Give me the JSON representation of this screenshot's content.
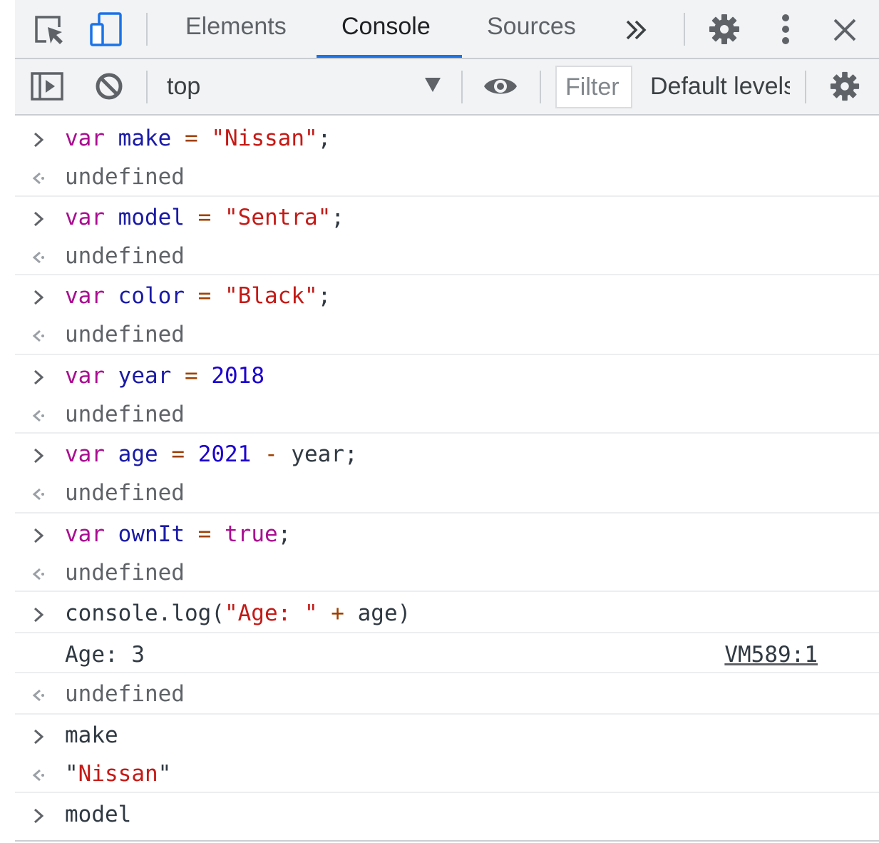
{
  "tabbar": {
    "tabs": [
      {
        "label": "Elements",
        "active": false
      },
      {
        "label": "Console",
        "active": true
      },
      {
        "label": "Sources",
        "active": false
      }
    ],
    "more_tabs_glyph": "»",
    "icons": [
      "inspect-element-icon",
      "device-toolbar-icon",
      "more-tabs-icon",
      "settings-gear-icon",
      "kebab-menu-icon",
      "close-icon"
    ]
  },
  "toolbar": {
    "context": "top",
    "filter_placeholder": "Filter",
    "filter_value": "",
    "levels": "Default levels",
    "icons": [
      "sidebar-toggle-icon",
      "clear-console-icon",
      "context-dropdown-icon",
      "live-expression-eye-icon",
      "console-settings-gear-icon"
    ]
  },
  "colors": {
    "accent": "#1a73e8",
    "keyword": "#aa0d91",
    "variable": "#1a1aa6",
    "string": "#c41a16",
    "number": "#1c00cf",
    "operator": "#a04000",
    "text": "#303942"
  },
  "console": {
    "entries": [
      {
        "kind": "input",
        "tokens": [
          [
            "kw",
            "var"
          ],
          [
            "pl",
            " "
          ],
          [
            "vd",
            "make"
          ],
          [
            "pl",
            " "
          ],
          [
            "op",
            "="
          ],
          [
            "pl",
            " "
          ],
          [
            "st",
            "\"Nissan\""
          ],
          [
            "pl",
            ";"
          ]
        ]
      },
      {
        "kind": "result",
        "tokens": [
          [
            "res",
            "undefined"
          ]
        ]
      },
      {
        "kind": "input",
        "tokens": [
          [
            "kw",
            "var"
          ],
          [
            "pl",
            " "
          ],
          [
            "vd",
            "model"
          ],
          [
            "pl",
            " "
          ],
          [
            "op",
            "="
          ],
          [
            "pl",
            " "
          ],
          [
            "st",
            "\"Sentra\""
          ],
          [
            "pl",
            ";"
          ]
        ]
      },
      {
        "kind": "result",
        "tokens": [
          [
            "res",
            "undefined"
          ]
        ]
      },
      {
        "kind": "input",
        "tokens": [
          [
            "kw",
            "var"
          ],
          [
            "pl",
            " "
          ],
          [
            "vd",
            "color"
          ],
          [
            "pl",
            " "
          ],
          [
            "op",
            "="
          ],
          [
            "pl",
            " "
          ],
          [
            "st",
            "\"Black\""
          ],
          [
            "pl",
            ";"
          ]
        ]
      },
      {
        "kind": "result",
        "tokens": [
          [
            "res",
            "undefined"
          ]
        ]
      },
      {
        "kind": "input",
        "tokens": [
          [
            "kw",
            "var"
          ],
          [
            "pl",
            " "
          ],
          [
            "vd",
            "year"
          ],
          [
            "pl",
            " "
          ],
          [
            "op",
            "="
          ],
          [
            "pl",
            " "
          ],
          [
            "nm",
            "2018"
          ]
        ]
      },
      {
        "kind": "result",
        "tokens": [
          [
            "res",
            "undefined"
          ]
        ]
      },
      {
        "kind": "input",
        "tokens": [
          [
            "kw",
            "var"
          ],
          [
            "pl",
            " "
          ],
          [
            "vd",
            "age"
          ],
          [
            "pl",
            " "
          ],
          [
            "op",
            "="
          ],
          [
            "pl",
            " "
          ],
          [
            "nm",
            "2021"
          ],
          [
            "pl",
            " "
          ],
          [
            "op",
            "-"
          ],
          [
            "pl",
            " year;"
          ]
        ]
      },
      {
        "kind": "result",
        "tokens": [
          [
            "res",
            "undefined"
          ]
        ]
      },
      {
        "kind": "input",
        "tokens": [
          [
            "kw",
            "var"
          ],
          [
            "pl",
            " "
          ],
          [
            "vd",
            "ownIt"
          ],
          [
            "pl",
            " "
          ],
          [
            "op",
            "="
          ],
          [
            "pl",
            " "
          ],
          [
            "kw",
            "true"
          ],
          [
            "pl",
            ";"
          ]
        ]
      },
      {
        "kind": "result",
        "tokens": [
          [
            "res",
            "undefined"
          ]
        ]
      },
      {
        "kind": "input",
        "tokens": [
          [
            "pl",
            "console.log("
          ],
          [
            "st",
            "\"Age: \""
          ],
          [
            "pl",
            " "
          ],
          [
            "op",
            "+"
          ],
          [
            "pl",
            " age)"
          ]
        ]
      },
      {
        "kind": "log",
        "tokens": [
          [
            "pl",
            "Age: 3"
          ]
        ],
        "source": "VM589:1"
      },
      {
        "kind": "result",
        "tokens": [
          [
            "res",
            "undefined"
          ]
        ]
      },
      {
        "kind": "input",
        "tokens": [
          [
            "pl",
            "make"
          ]
        ]
      },
      {
        "kind": "result",
        "tokens": [
          [
            "pl",
            "\""
          ],
          [
            "st",
            "Nissan"
          ],
          [
            "pl",
            "\""
          ]
        ]
      },
      {
        "kind": "input",
        "tokens": [
          [
            "pl",
            "model"
          ]
        ]
      }
    ]
  }
}
